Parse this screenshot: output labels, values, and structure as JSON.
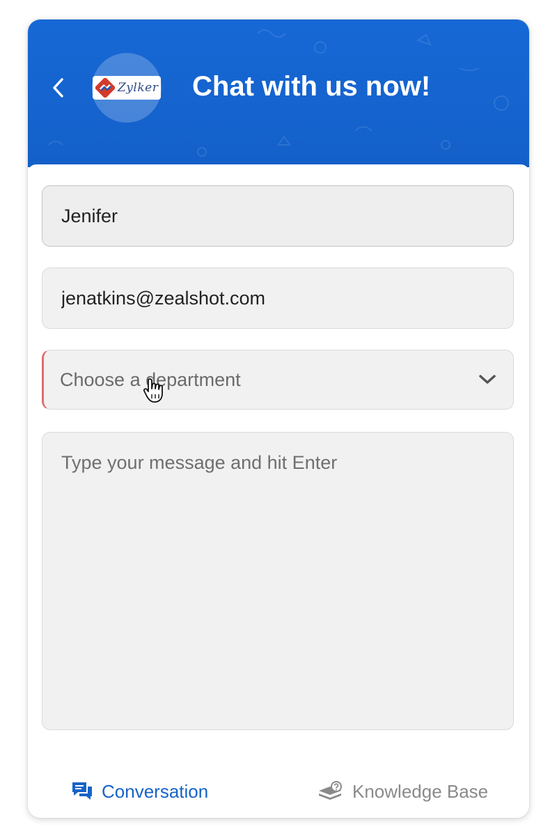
{
  "header": {
    "title": "Chat with us now!",
    "logo_text": "Zylker",
    "back_icon": "chevron-left-icon",
    "brand_color": "#1668d6"
  },
  "form": {
    "name_value": "Jenifer",
    "name_placeholder": "",
    "email_value": "jenatkins@zealshot.com",
    "email_placeholder": "",
    "department_placeholder": "Choose a department",
    "department_icon": "chevron-down-icon",
    "message_placeholder": "Type your message and hit Enter",
    "required_indicator_color": "#e06c6c"
  },
  "tabs": [
    {
      "label": "Conversation",
      "icon": "chat-bubbles-icon",
      "active": true,
      "color": "#1763c7"
    },
    {
      "label": "Knowledge Base",
      "icon": "books-help-icon",
      "active": false,
      "color": "#8a8a8a"
    }
  ]
}
